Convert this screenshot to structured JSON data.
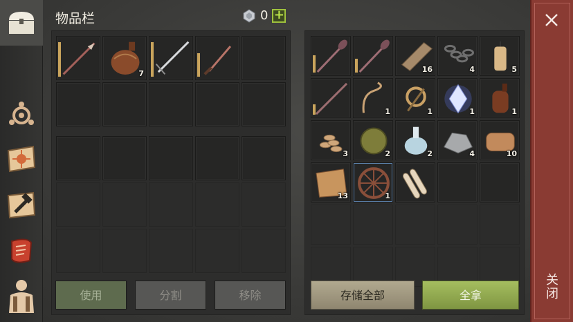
{
  "title": "物品栏",
  "currency": {
    "count": "0",
    "add_label": "+"
  },
  "close": {
    "label": "关闭"
  },
  "buttons": {
    "use": "使用",
    "split": "分割",
    "remove": "移除",
    "store_all": "存储全部",
    "take_all": "全拿"
  },
  "sidebar": [
    "chest-icon",
    "crafting-icon",
    "map-scroll-icon",
    "build-hammer-icon",
    "quest-scroll-icon",
    "character-icon"
  ],
  "inventory": [
    {
      "item": "spear",
      "qty": "",
      "durability": 0.9
    },
    {
      "item": "flask",
      "qty": "7"
    },
    {
      "item": "sword",
      "qty": "",
      "durability": 0.9
    },
    {
      "item": "knife",
      "qty": "",
      "durability": 0.6
    }
  ],
  "storage": [
    {
      "item": "mace",
      "qty": "",
      "durability": 0.5
    },
    {
      "item": "mace",
      "qty": "",
      "durability": 0.4
    },
    {
      "item": "wood-plank",
      "qty": "16"
    },
    {
      "item": "chain",
      "qty": "4"
    },
    {
      "item": "candle",
      "qty": "5"
    },
    {
      "item": "pole",
      "qty": "",
      "durability": 0.3
    },
    {
      "item": "rope",
      "qty": "1"
    },
    {
      "item": "hook",
      "qty": "1"
    },
    {
      "item": "crystal",
      "qty": "1"
    },
    {
      "item": "bottle",
      "qty": "1"
    },
    {
      "item": "seeds",
      "qty": "3"
    },
    {
      "item": "fiber-ball",
      "qty": "2"
    },
    {
      "item": "potion",
      "qty": "2"
    },
    {
      "item": "stone",
      "qty": "4"
    },
    {
      "item": "leather",
      "qty": "10"
    },
    {
      "item": "cloth",
      "qty": "13"
    },
    {
      "item": "wheel",
      "qty": "1",
      "selected": true
    },
    {
      "item": "scroll-bundle",
      "qty": ""
    }
  ],
  "colors": {
    "take_all": "#8fa84e",
    "store_all": "#a39b82",
    "close": "#8a3b33",
    "currency_add": "#9fc23d"
  }
}
